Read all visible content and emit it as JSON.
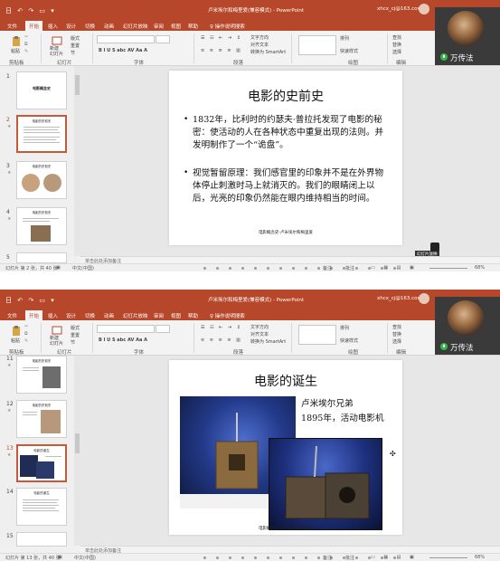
{
  "app": {
    "quick_access": "日 ↶ ↷ ▭ ▾",
    "document_title": "卢米埃尔和梅里爱(兼容模式) - PowerPoint",
    "account": "xhcx_cj@163.com",
    "ribbon_tabs": [
      "文件",
      "开始",
      "插入",
      "设计",
      "切换",
      "动画",
      "幻灯片放映",
      "审阅",
      "视图",
      "帮助"
    ],
    "tell_me": "♀ 操作说明搜索",
    "ribbon": {
      "paste": "粘贴",
      "clipboard": "剪贴板",
      "new_slide": "新建\n幻灯片",
      "layout": "版式",
      "reset": "重置",
      "section": "节",
      "slides": "幻灯片",
      "font": "字体",
      "paragraph": "段落",
      "drawing": "绘图",
      "editing": "编辑",
      "text_direction": "文字方向",
      "align_text": "对齐文本",
      "smartart": "转换为 SmartArt",
      "find": "查找",
      "replace": "替换",
      "select": "选择",
      "font_buttons": "B I U S abc AV Aa A",
      "arrange": "排列",
      "quick_styles": "快速样式"
    },
    "notes_placeholder": "单击此处添加备注",
    "status_notes": "备注",
    "status_comments": "批注",
    "zoom": "68%"
  },
  "video": {
    "name": "万传法"
  },
  "screen1": {
    "thumbnails": [
      {
        "number": "1",
        "title": "电影概念史",
        "selected": false
      },
      {
        "number": "2",
        "title": "电影的史前史",
        "selected": true
      },
      {
        "number": "3",
        "title": "电影的史前史",
        "selected": false
      },
      {
        "number": "4",
        "title": "电影的史前史",
        "selected": false
      },
      {
        "number": "5",
        "title": "",
        "selected": false
      }
    ],
    "slide": {
      "title": "电影的史前史",
      "bullets": [
        "1832年，比利时的约瑟夫·普拉托发现了电影的秘密：使活动的人在各种状态中重复出现的法则。并发明制作了一个“诡盘”。",
        "视觉暂留原理：我们感官里的印象并不是在外界物体停止刺激时马上就消灭的。我们的眼睛闭上以后，光亮的印象仍然能在眼内维持相当的时间。"
      ],
      "footer": "电影概念史-卢米埃尔和梅里爱"
    },
    "status_left": "幻灯片 第 2 张，共 40 张",
    "language": "中文(中国)",
    "tooltip": "幻灯片放映"
  },
  "screen2": {
    "thumbnails": [
      {
        "number": "11",
        "title": "电影的史前史",
        "selected": false
      },
      {
        "number": "12",
        "title": "电影的史前史",
        "selected": false
      },
      {
        "number": "13",
        "title": "电影的诞生",
        "selected": true
      },
      {
        "number": "14",
        "title": "电影的诞生",
        "selected": false
      },
      {
        "number": "15",
        "title": "",
        "selected": false
      }
    ],
    "slide": {
      "title": "电影的诞生",
      "caption_line1": "卢米埃尔兄弟",
      "caption_line2": "1895年，活动电影机",
      "footer": "电影概念史-卢米埃尔和梅里爱"
    },
    "status_left": "幻灯片 第 13 张，共 40 张",
    "language": "中文(中国)"
  }
}
